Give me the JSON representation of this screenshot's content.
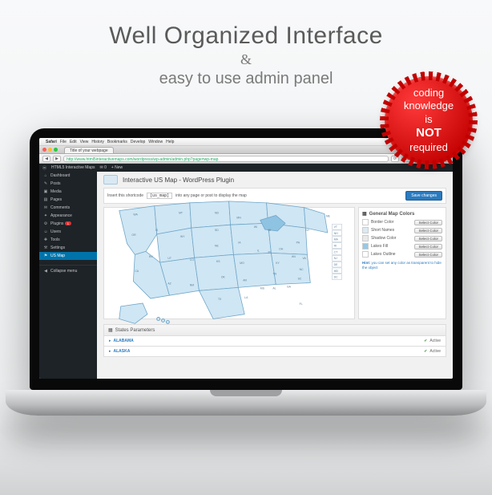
{
  "hero": {
    "title": "Well Organized Interface",
    "amp": "&",
    "subtitle": "easy to use admin panel"
  },
  "badge": {
    "line1": "coding",
    "line2": "knowledge",
    "line3": "is",
    "not": "NOT",
    "line5": "required"
  },
  "menubar": {
    "apple": "",
    "app": "Safari",
    "items": [
      "File",
      "Edit",
      "View",
      "History",
      "Bookmarks",
      "Develop",
      "Window",
      "Help"
    ]
  },
  "browser": {
    "tab_title": "Title of your webpage",
    "url": "http://www.html5interactivemaps.com/wordpress/wp-admin/admin.php?page=wp-map",
    "search_placeholder": "Google",
    "dot_colors": [
      "#ff5f57",
      "#febc2e",
      "#28c840"
    ]
  },
  "adminbar": {
    "site": "HTML5 Interactive Maps",
    "comments": "0",
    "new": "+ New"
  },
  "sidebar": {
    "items": [
      {
        "icon": "⌂",
        "label": "Dashboard"
      },
      {
        "icon": "✎",
        "label": "Posts"
      },
      {
        "icon": "▣",
        "label": "Media"
      },
      {
        "icon": "▤",
        "label": "Pages"
      },
      {
        "icon": "✉",
        "label": "Comments"
      },
      {
        "icon": "✦",
        "label": "Appearance"
      },
      {
        "icon": "⚙",
        "label": "Plugins",
        "badge": "1"
      },
      {
        "icon": "☺",
        "label": "Users"
      },
      {
        "icon": "✚",
        "label": "Tools"
      },
      {
        "icon": "⚒",
        "label": "Settings"
      },
      {
        "icon": "⚑",
        "label": "US Map",
        "active": true
      }
    ],
    "collapse": "Collapse menu"
  },
  "page": {
    "title": "Interactive US Map - WordPress Plugin",
    "shortcode_pre": "Insert this shortcode",
    "shortcode": "[us_map]",
    "shortcode_post": "into any page or post to display the map",
    "save": "Save changes"
  },
  "colors_panel": {
    "heading": "General Map Colors",
    "rows": [
      {
        "swatch": "#ffffff",
        "name": "Border Color",
        "btn": "Select Color"
      },
      {
        "swatch": "#dbe9f2",
        "name": "Short Names",
        "btn": "Select Color"
      },
      {
        "swatch": "#e9e9e9",
        "name": "Shadow Color",
        "btn": "Select Color"
      },
      {
        "swatch": "#99c7e4",
        "name": "Lakes Fill",
        "btn": "Select Color"
      },
      {
        "swatch": "#ffffff",
        "name": "Lakes Outline",
        "btn": "Select Color"
      }
    ],
    "hint_bold": "Hint:",
    "hint": "you can set any color as transparent to hide the object"
  },
  "states_section": {
    "heading": "States Parameters",
    "rows": [
      {
        "name": "ALABAMA",
        "status": "Active"
      },
      {
        "name": "ALASKA",
        "status": "Active"
      }
    ]
  },
  "map_labels": [
    "WA",
    "OR",
    "CA",
    "NV",
    "ID",
    "MT",
    "WY",
    "UT",
    "AZ",
    "CO",
    "NM",
    "ND",
    "SD",
    "NE",
    "KS",
    "OK",
    "TX",
    "MN",
    "IA",
    "MO",
    "AR",
    "LA",
    "WI",
    "IL",
    "MI",
    "IN",
    "OH",
    "KY",
    "TN",
    "MS",
    "AL",
    "GA",
    "FL",
    "SC",
    "NC",
    "VA",
    "WV",
    "PA",
    "NY",
    "ME",
    "VT",
    "NH",
    "MA",
    "RI",
    "CT",
    "NJ",
    "DE",
    "MD",
    "DC"
  ]
}
